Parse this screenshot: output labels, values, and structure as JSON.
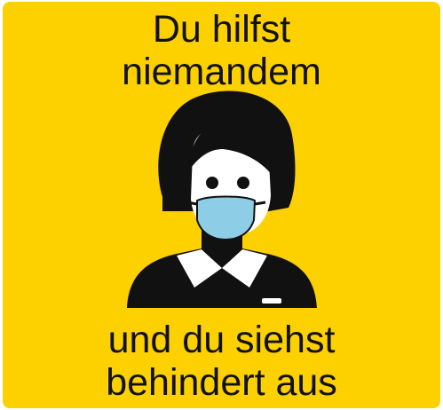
{
  "meme": {
    "top_lines": [
      "Du hilfst",
      "niemandem"
    ],
    "bottom_lines": [
      "und du siehst",
      "behindert aus"
    ]
  },
  "colors": {
    "background": "#fdd000",
    "figure": "#111111",
    "mask": "#8ecde6",
    "text": "#111111"
  },
  "icons": {
    "figure": "person-with-face-mask-icon"
  }
}
